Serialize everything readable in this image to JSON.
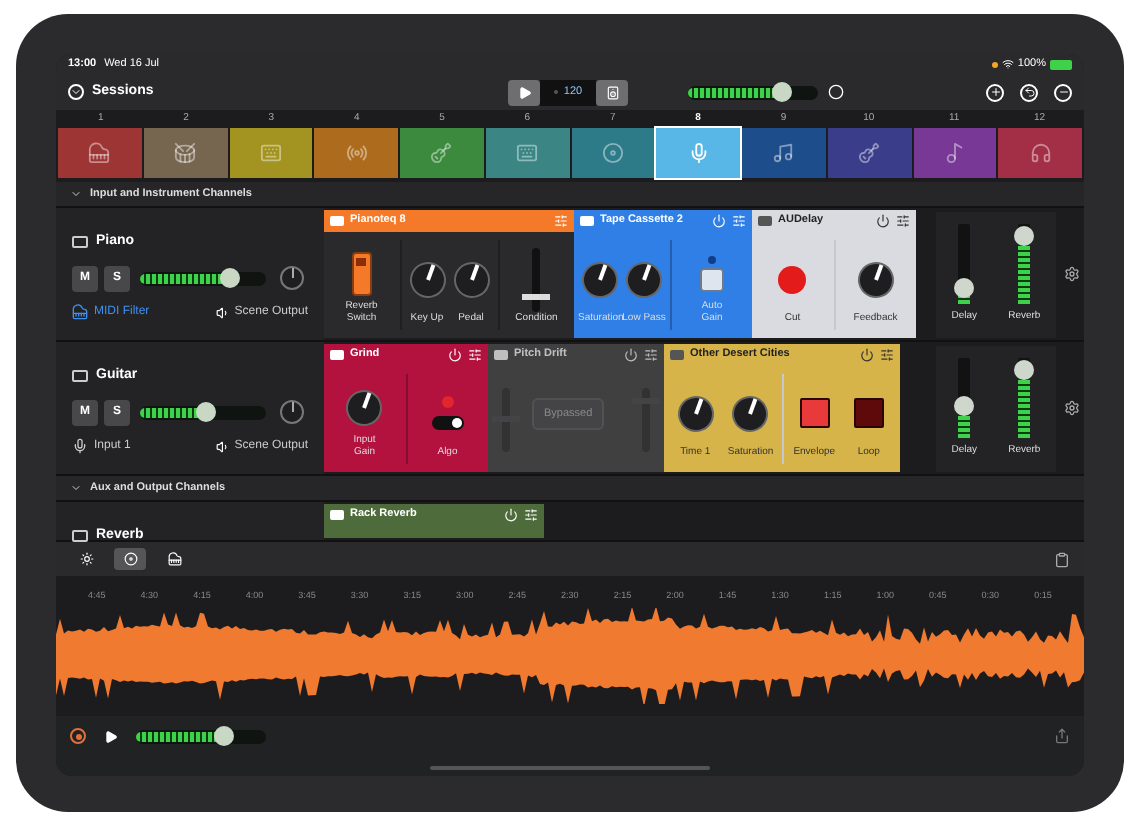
{
  "status_bar": {
    "time": "13:00",
    "date": "Wed 16 Jul",
    "battery": "100%"
  },
  "toolbar": {
    "title": "Sessions",
    "tempo": "120",
    "master": {
      "level": 0.72
    }
  },
  "scenes": [
    {
      "number": "1",
      "color": "#9e3535",
      "selected": false
    },
    {
      "number": "2",
      "color": "#77664f",
      "selected": false
    },
    {
      "number": "3",
      "color": "#a39320",
      "selected": false
    },
    {
      "number": "4",
      "color": "#ad6c1d",
      "selected": false
    },
    {
      "number": "5",
      "color": "#3c8a3e",
      "selected": false
    },
    {
      "number": "6",
      "color": "#3b8585",
      "selected": false
    },
    {
      "number": "7",
      "color": "#2d7a89",
      "selected": false
    },
    {
      "number": "8",
      "color": "#58b7e6",
      "selected": true
    },
    {
      "number": "9",
      "color": "#1d4d8a",
      "selected": false
    },
    {
      "number": "10",
      "color": "#3a3d8a",
      "selected": false
    },
    {
      "number": "11",
      "color": "#773896",
      "selected": false
    },
    {
      "number": "12",
      "color": "#a32f47",
      "selected": false
    }
  ],
  "sections": [
    {
      "title": "Input and Instrument Channels",
      "expanded": true,
      "channels": [
        {
          "name": "Piano",
          "mute_label": "M",
          "solo_label": "S",
          "mute": false,
          "solo": false,
          "fader": {
            "level": 0.72
          },
          "input": {
            "kind": "midi",
            "label": "MIDI Filter"
          },
          "output": "Scene Output",
          "plugins": [
            {
              "name": "Pianoteq 8",
              "color": "#f47a2a",
              "kind": "dark",
              "power_button": false,
              "bypassed": false,
              "groups": [
                [
                  {
                    "kind": "switch",
                    "label": "Reverb Switch"
                  }
                ],
                [
                  {
                    "kind": "knob",
                    "label": "Key Up"
                  },
                  {
                    "kind": "knob",
                    "label": "Pedal"
                  }
                ],
                [
                  {
                    "kind": "fader",
                    "label": "Condition",
                    "level": 0.2
                  }
                ]
              ]
            },
            {
              "name": "Tape Cassette 2",
              "color": "#2f7fe6",
              "kind": "plain",
              "power_button": true,
              "bypassed": false,
              "groups": [
                [
                  {
                    "kind": "knob",
                    "label": "Saturation"
                  },
                  {
                    "kind": "knob",
                    "label": "Low Pass"
                  }
                ],
                [
                  {
                    "kind": "button",
                    "label": "Auto Gain",
                    "on": false
                  }
                ]
              ]
            },
            {
              "name": "AUDelay",
              "color": "#d9dbe0",
              "kind": "plain",
              "power_button": true,
              "bypassed": false,
              "groups": [
                [
                  {
                    "kind": "record",
                    "label": "Cut"
                  }
                ],
                [
                  {
                    "kind": "knob",
                    "label": "Feedback"
                  }
                ]
              ]
            }
          ],
          "sends": [
            {
              "label": "Delay",
              "level": 0.2
            },
            {
              "label": "Reverb",
              "level": 0.85
            }
          ]
        },
        {
          "name": "Guitar",
          "mute_label": "M",
          "solo_label": "S",
          "mute": false,
          "solo": false,
          "fader": {
            "level": 0.52
          },
          "input": {
            "kind": "audio",
            "label": "Input 1"
          },
          "output": "Scene Output",
          "plugins": [
            {
              "name": "Grind",
              "color": "#b3123f",
              "kind": "plain",
              "power_button": true,
              "bypassed": false,
              "groups": [
                [
                  {
                    "kind": "knob",
                    "label": "Input Gain"
                  }
                ],
                [
                  {
                    "kind": "toggle",
                    "label": "Algo",
                    "on": true
                  }
                ]
              ]
            },
            {
              "name": "Pitch Drift",
              "color": "#555557",
              "kind": "plain",
              "power_button": true,
              "bypassed": true,
              "overlay": "Bypassed",
              "groups": [
                [
                  {
                    "kind": "fader",
                    "level": 0.5
                  },
                  {
                    "kind": "fader",
                    "level": 0.8
                  }
                ]
              ]
            },
            {
              "name": "Other Desert Cities",
              "color": "#d6b44a",
              "kind": "plain",
              "power_button": true,
              "bypassed": false,
              "groups": [
                [
                  {
                    "kind": "knob",
                    "label": "Time 1"
                  },
                  {
                    "kind": "knob",
                    "label": "Saturation"
                  }
                ],
                [
                  {
                    "kind": "pad",
                    "label": "Envelope",
                    "on": true
                  },
                  {
                    "kind": "pad",
                    "label": "Loop",
                    "on": false
                  }
                ]
              ]
            }
          ],
          "sends": [
            {
              "label": "Delay",
              "level": 0.4
            },
            {
              "label": "Reverb",
              "level": 0.85
            }
          ]
        }
      ]
    },
    {
      "title": "Aux and Output Channels",
      "expanded": true,
      "channels": [
        {
          "name": "Reverb",
          "plugins": [
            {
              "name": "Rack Reverb",
              "color": "#4e6b3b",
              "kind": "plain",
              "power_button": true,
              "bypassed": false
            }
          ]
        }
      ]
    }
  ],
  "tools": [
    {
      "selected": false
    },
    {
      "selected": true
    },
    {
      "selected": false
    }
  ],
  "timeline": {
    "ticks": [
      "4:45",
      "4:30",
      "4:15",
      "4:00",
      "3:45",
      "3:30",
      "3:15",
      "3:00",
      "2:45",
      "2:30",
      "2:15",
      "2:00",
      "1:45",
      "1:30",
      "1:15",
      "1:00",
      "0:45",
      "0:30",
      "0:15"
    ]
  },
  "transport": {
    "volume": {
      "level": 0.68
    }
  }
}
